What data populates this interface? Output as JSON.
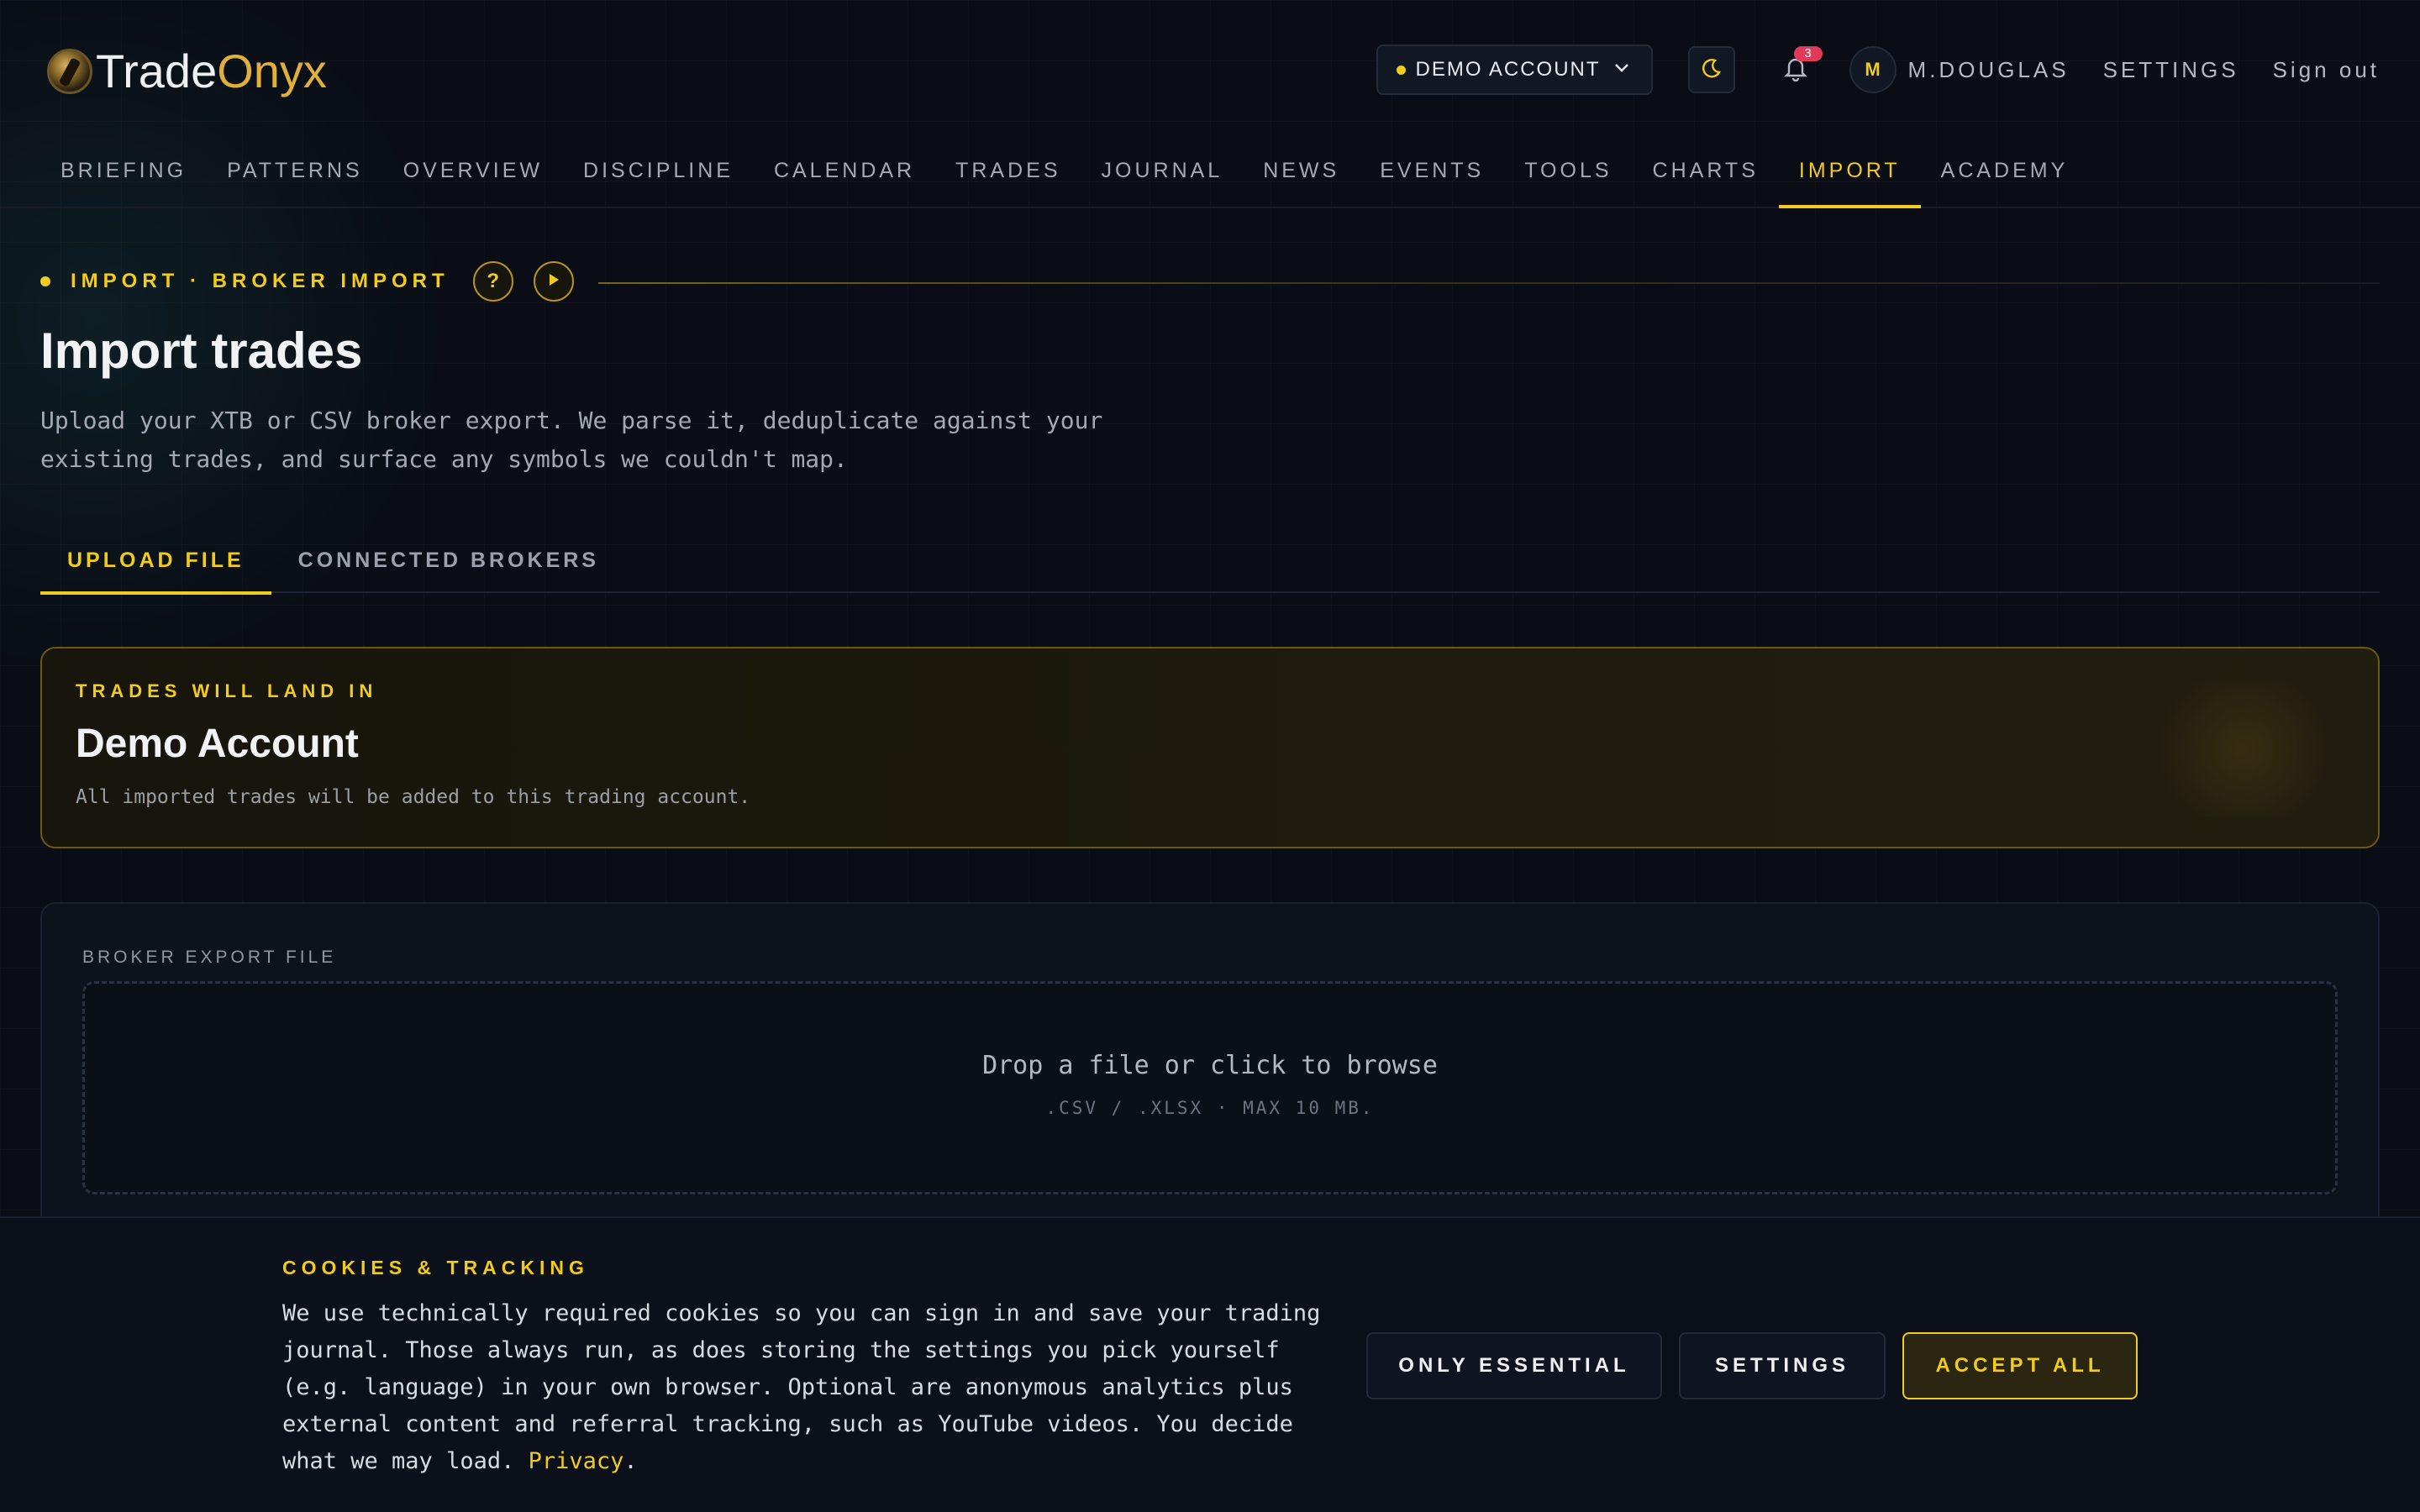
{
  "brand": {
    "name_part1": "Trade",
    "name_part2": "Onyx",
    "accent": "#f2cc1c",
    "logo_gold": "#e0b03c"
  },
  "header": {
    "account_selector": "DEMO ACCOUNT",
    "theme_icon": "moon-icon",
    "notification_count": "3",
    "avatar_initial": "M",
    "username": "M.DOUGLAS",
    "settings_label": "SETTINGS",
    "signout_label": "Sign out"
  },
  "nav": {
    "items": [
      "BRIEFING",
      "PATTERNS",
      "OVERVIEW",
      "DISCIPLINE",
      "CALENDAR",
      "TRADES",
      "JOURNAL",
      "NEWS",
      "EVENTS",
      "TOOLS",
      "CHARTS",
      "IMPORT",
      "ACADEMY"
    ],
    "active": "IMPORT"
  },
  "breadcrumb": {
    "text": "IMPORT · BROKER IMPORT",
    "help_icon_glyph": "?"
  },
  "page": {
    "title": "Import trades",
    "subtitle": "Upload your XTB or CSV broker export. We parse it, deduplicate against your existing trades, and surface any symbols we couldn't map."
  },
  "tabs": {
    "upload": "UPLOAD FILE",
    "brokers": "CONNECTED BROKERS",
    "active": "UPLOAD FILE"
  },
  "landing": {
    "label": "TRADES WILL LAND IN",
    "account": "Demo Account",
    "note": "All imported trades will be added to this trading account."
  },
  "upload": {
    "label": "BROKER EXPORT FILE",
    "drop_text": "Drop a file or click to browse",
    "formats": ".CSV / .XLSX · MAX 10 MB."
  },
  "cookie": {
    "title": "COOKIES & TRACKING",
    "text": "We use technically required cookies so you can sign in and save your trading journal. Those always run, as does storing the settings you pick yourself (e.g. language) in your own browser. Optional are anonymous analytics plus external content and referral tracking, such as YouTube videos. You decide what we may load. ",
    "link": "Privacy",
    "link_suffix": ".",
    "btn_essential": "ONLY ESSENTIAL",
    "btn_settings": "SETTINGS",
    "btn_accept": "ACCEPT ALL"
  }
}
